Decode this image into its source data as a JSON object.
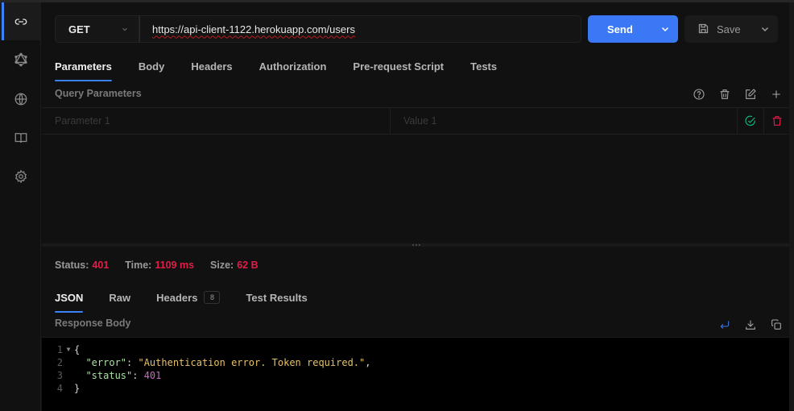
{
  "sidebar": {
    "items": [
      {
        "name": "link",
        "icon": "link-icon",
        "active": true
      },
      {
        "name": "graphql",
        "icon": "graphql-icon",
        "active": false
      },
      {
        "name": "realtime",
        "icon": "globe-icon",
        "active": false
      },
      {
        "name": "docs",
        "icon": "book-icon",
        "active": false
      },
      {
        "name": "settings",
        "icon": "gear-icon",
        "active": false
      }
    ]
  },
  "request": {
    "method": "GET",
    "url": "https://api-client-1122.herokuapp.com/users",
    "send_label": "Send",
    "save_label": "Save"
  },
  "request_tabs": [
    "Parameters",
    "Body",
    "Headers",
    "Authorization",
    "Pre-request Script",
    "Tests"
  ],
  "active_request_tab": "Parameters",
  "query_params": {
    "title": "Query Parameters",
    "actions": [
      "help-icon",
      "trash-icon",
      "edit-icon",
      "plus-icon"
    ],
    "rows": [
      {
        "key_placeholder": "Parameter 1",
        "value_placeholder": "Value 1",
        "enabled": true
      }
    ]
  },
  "response": {
    "status_label": "Status:",
    "status": "401",
    "time_label": "Time:",
    "time": "1109 ms",
    "size_label": "Size:",
    "size": "62 B",
    "tabs": [
      {
        "label": "JSON"
      },
      {
        "label": "Raw"
      },
      {
        "label": "Headers",
        "badge": "8"
      },
      {
        "label": "Test Results"
      }
    ],
    "active_tab": "JSON",
    "body_title": "Response Body",
    "body_lines": [
      {
        "n": "1",
        "fold": true
      },
      {
        "n": "2"
      },
      {
        "n": "3"
      },
      {
        "n": "4"
      }
    ],
    "body": {
      "open": "{",
      "error_key": "\"error\"",
      "error_value": "\"Authentication error. Token required.\"",
      "status_key": "\"status\"",
      "status_value": "401",
      "close": "}"
    }
  },
  "colors": {
    "accent": "#3b78f5",
    "error": "#e11d48",
    "success": "#10b981"
  }
}
